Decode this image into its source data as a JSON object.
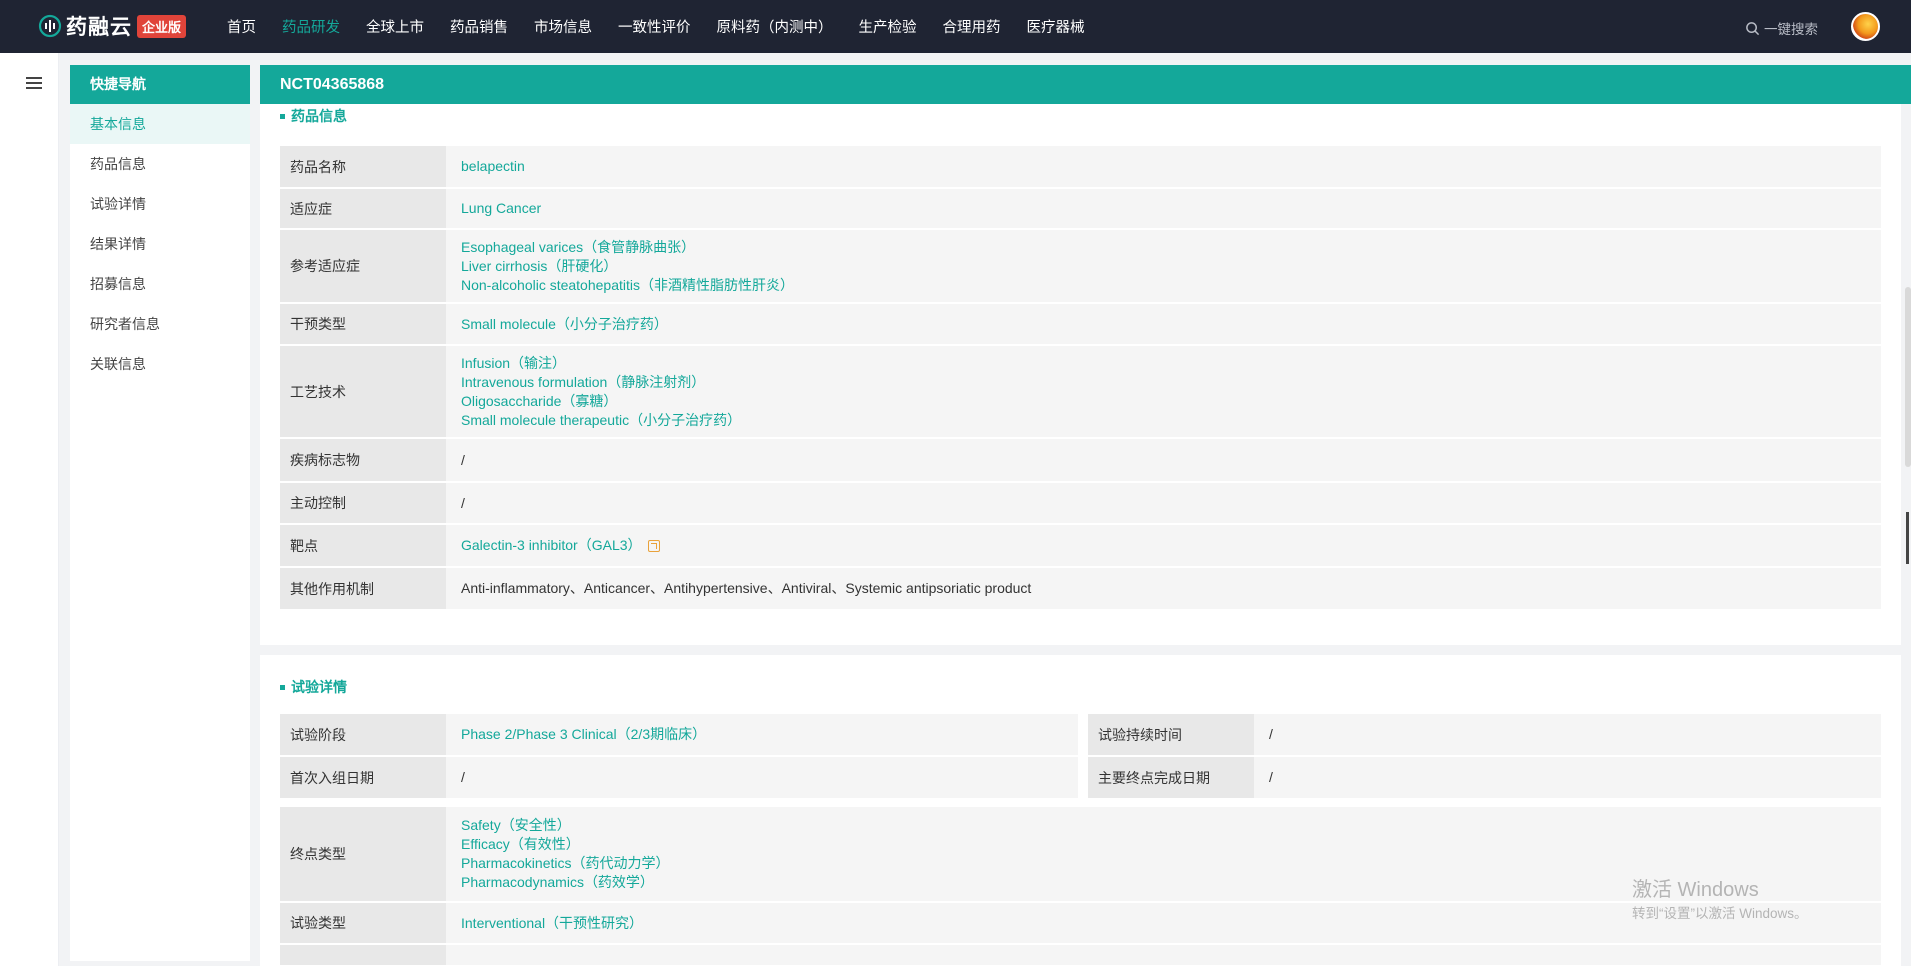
{
  "header": {
    "logo_text": "药融云",
    "logo_badge": "企业版",
    "nav": [
      "首页",
      "药品研发",
      "全球上市",
      "药品销售",
      "市场信息",
      "一致性评价",
      "原料药（内测中）",
      "生产检验",
      "合理用药",
      "医疗器械"
    ],
    "active_nav": "药品研发",
    "search_label": "一键搜索"
  },
  "quicknav": {
    "title": "快捷导航",
    "items": [
      "基本信息",
      "药品信息",
      "试验详情",
      "结果详情",
      "招募信息",
      "研究者信息",
      "关联信息"
    ],
    "active": "基本信息"
  },
  "main": {
    "trial_id": "NCT04365868",
    "drug_section": {
      "title": "药品信息",
      "rows": [
        {
          "label": "药品名称",
          "values": [
            "belapectin"
          ]
        },
        {
          "label": "适应症",
          "values": [
            "Lung Cancer"
          ]
        },
        {
          "label": "参考适应症",
          "values": [
            "Esophageal varices（食管静脉曲张）",
            "Liver cirrhosis（肝硬化）",
            "Non-alcoholic steatohepatitis（非酒精性脂肪性肝炎）"
          ]
        },
        {
          "label": "干预类型",
          "values": [
            "Small molecule（小分子治疗药）"
          ]
        },
        {
          "label": "工艺技术",
          "values": [
            "Infusion（输注）",
            "Intravenous formulation（静脉注射剂）",
            "Oligosaccharide（寡糖）",
            "Small molecule therapeutic（小分子治疗药）"
          ]
        },
        {
          "label": "疾病标志物",
          "values": [
            "/"
          ]
        },
        {
          "label": "主动控制",
          "values": [
            "/"
          ]
        },
        {
          "label": "靶点",
          "values": [
            "Galectin-3 inhibitor（GAL3）"
          ]
        },
        {
          "label": "其他作用机制",
          "values": [
            "Anti-inflammatory、Anticancer、Antihypertensive、Antiviral、Systemic antipsoriatic product"
          ]
        }
      ]
    },
    "trial_section": {
      "title": "试验详情",
      "grid": [
        {
          "label": "试验阶段",
          "value": "Phase 2/Phase 3 Clinical（2/3期临床）",
          "label2": "试验持续时间",
          "value2": "/"
        },
        {
          "label": "首次入组日期",
          "value": "/",
          "label2": "主要终点完成日期",
          "value2": "/"
        }
      ],
      "rows": [
        {
          "label": "终点类型",
          "values": [
            "Safety（安全性）",
            "Efficacy（有效性）",
            "Pharmacokinetics（药代动力学）",
            "Pharmacodynamics（药效学）"
          ]
        },
        {
          "label": "试验类型",
          "values": [
            "Interventional（干预性研究）"
          ]
        }
      ]
    }
  },
  "watermark": {
    "title": "激活 Windows",
    "subtitle": "转到“设置”以激活 Windows。"
  },
  "colors": {
    "accent": "#14a89a",
    "topbar": "#1f2433",
    "badge": "#e0443a"
  }
}
